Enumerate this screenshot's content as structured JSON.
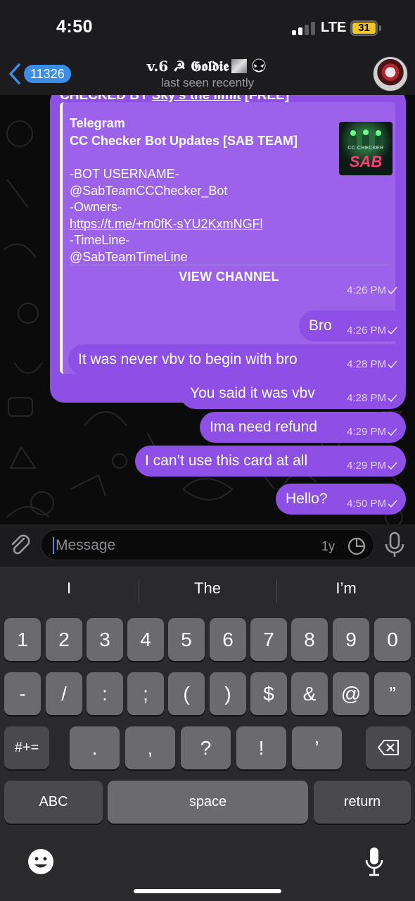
{
  "status_bar": {
    "time": "4:50",
    "network": "LTE",
    "battery": "31"
  },
  "header": {
    "back_count": "11326",
    "title": "v.6 ☭ 𝕲𝖔𝖑𝖉𝖎𝖊",
    "subtitle": "last seen recently"
  },
  "forwarded": {
    "checked_prefix": "CHECKED BY ",
    "checked_name": "Sky's the limit",
    "checked_suffix": " [FREE]",
    "site_name": "Telegram",
    "title": "CC Checker Bot Updates [SAB TEAM]",
    "thumb_caption": "CC CHECKER",
    "thumb_brand": "SAB",
    "description": [
      "-BOT USERNAME-",
      "@SabTeamCCChecker_Bot",
      " -Owners-",
      "https://t.me/+m0fK-sYU2KxmNGFl",
      " -TimeLine-",
      "@SabTeamTimeLine"
    ],
    "button_label": "VIEW CHANNEL",
    "time": "4:26 PM"
  },
  "messages": [
    {
      "text": "Bro",
      "time": "4:26 PM"
    },
    {
      "text": "It was never vbv to begin with bro",
      "time": "4:28 PM"
    },
    {
      "text": "You said it was vbv",
      "time": "4:28 PM"
    },
    {
      "text": "Ima need refund",
      "time": "4:29 PM"
    },
    {
      "text": "I can’t use this card at all",
      "time": "4:29 PM"
    },
    {
      "text": "Hello?",
      "time": "4:50 PM"
    }
  ],
  "input": {
    "placeholder": "Message",
    "timer_label": "1y"
  },
  "keyboard": {
    "suggestions": [
      "I",
      "The",
      "I’m"
    ],
    "row1": [
      "1",
      "2",
      "3",
      "4",
      "5",
      "6",
      "7",
      "8",
      "9",
      "0"
    ],
    "row2": [
      "-",
      "/",
      ":",
      ";",
      "(",
      ")",
      "$",
      "&",
      "@",
      "”"
    ],
    "row3_shift": "#+=",
    "row3": [
      ".",
      ",",
      "?",
      "!",
      "’"
    ],
    "abc": "ABC",
    "space": "space",
    "return": "return"
  },
  "colors": {
    "bubble": "#8d4fe5",
    "accent": "#3a8ee8",
    "battery": "#f3c623"
  }
}
